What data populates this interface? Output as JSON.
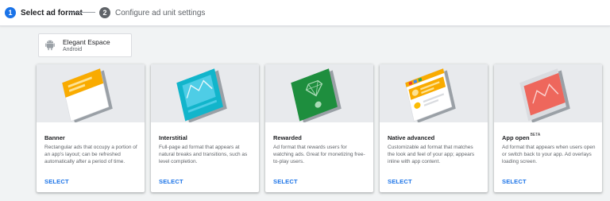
{
  "stepper": {
    "steps": [
      {
        "number": "1",
        "label": "Select ad format"
      },
      {
        "number": "2",
        "label": "Configure ad unit settings"
      }
    ]
  },
  "app": {
    "name": "Elegant Espace",
    "platform": "Android",
    "icon": "android-icon"
  },
  "cards": [
    {
      "title": "Banner",
      "badge": "",
      "description": "Rectangular ads that occupy a portion of an app's layout; can be refreshed automatically after a period of time.",
      "action": "SELECT",
      "color": "#f9ab00"
    },
    {
      "title": "Interstitial",
      "badge": "",
      "description": "Full-page ad format that appears at natural breaks and transitions, such as level completion.",
      "action": "SELECT",
      "color": "#12b5cb"
    },
    {
      "title": "Rewarded",
      "badge": "",
      "description": "Ad format that rewards users for watching ads. Great for monetizing free-to-play users.",
      "action": "SELECT",
      "color": "#1e8e3e"
    },
    {
      "title": "Native advanced",
      "badge": "",
      "description": "Customizable ad format that matches the look and feel of your app; appears inline with app content.",
      "action": "SELECT",
      "color": "#f9ab00"
    },
    {
      "title": "App open",
      "badge": "BETA",
      "description": "Ad format that appears when users open or switch back to your app. Ad overlays loading screen.",
      "action": "SELECT",
      "color": "#ee675c"
    }
  ],
  "colors": {
    "accent": "#1a73e8",
    "background": "#f1f3f4"
  }
}
